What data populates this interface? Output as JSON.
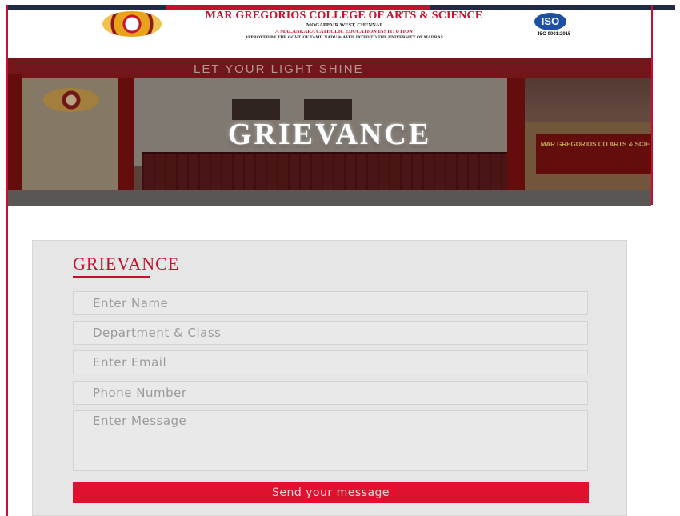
{
  "header": {
    "college_name": "MAR GREGORIOS COLLEGE OF ARTS & SCIENCE",
    "location": "MOGAPPAIR WEST, CHENNAI",
    "tagline": "A MALANKARA CATHOLIC EDUCATION INSTITUTION",
    "affiliation": "APPROVED BY THE GOVT. OF TAMILNADU & AFFILIATED TO THE UNIVERSITY OF MADRAS",
    "iso_mark": "ISO",
    "iso_text": "ISO 9001:2015"
  },
  "hero": {
    "sign_text": "LET YOUR LIGHT SHINE",
    "title": "GRIEVANCE",
    "wall_sign": "MAR GREGORIOS CO ARTS & SCIE"
  },
  "form": {
    "title": "GRIEVANCE",
    "fields": {
      "name_placeholder": "Enter Name",
      "department_placeholder": "Department & Class",
      "email_placeholder": "Enter Email",
      "phone_placeholder": "Phone Number",
      "message_placeholder": "Enter Message"
    },
    "submit_label": "Send your message"
  },
  "colors": {
    "accent": "#c8102e",
    "button": "#e0102f",
    "card_bg": "#e6e6e6"
  }
}
